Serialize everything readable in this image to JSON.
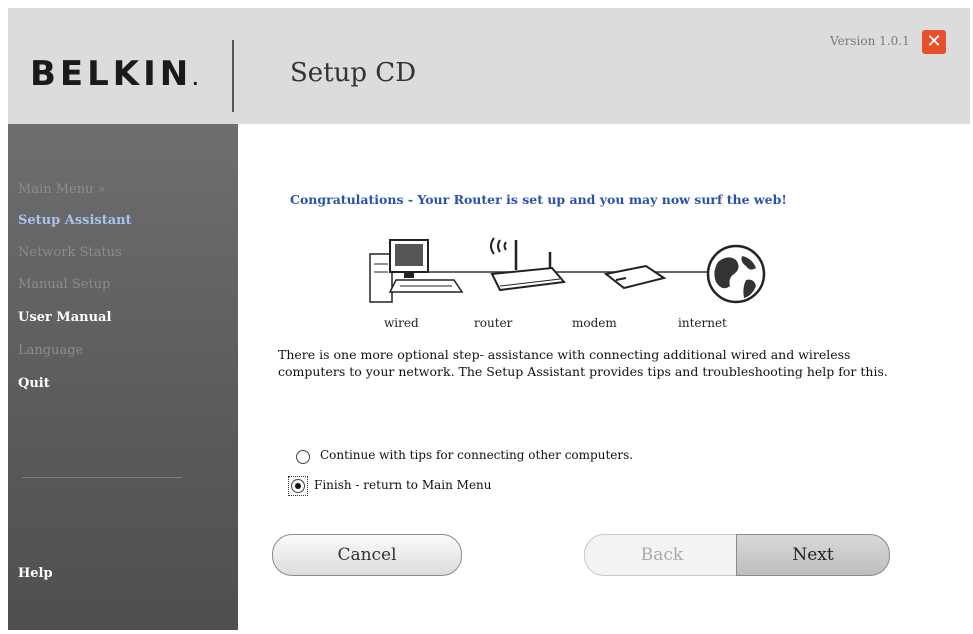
{
  "header": {
    "logo_text": "BELKIN",
    "logo_mark": ".",
    "title": "Setup CD",
    "version": "Version 1.0.1",
    "close_glyph": "✕",
    "close_icon": "close-icon",
    "accent_color": "#e8502d"
  },
  "sidebar": {
    "items": [
      {
        "label": "Main Menu  »"
      },
      {
        "label": "Setup Assistant"
      },
      {
        "label": "Network Status"
      },
      {
        "label": "Manual Setup"
      },
      {
        "label": "User Manual"
      },
      {
        "label": "Language"
      },
      {
        "label": "Quit"
      }
    ],
    "help": "Help"
  },
  "main": {
    "congrats": "Congratulations - Your Router is set up and you may now surf the web!",
    "diagram_labels": [
      "wired",
      "router",
      "modem",
      "internet"
    ],
    "paragraph": "There is one more optional step- assistance with connecting additional wired and wireless computers to your network. The Setup Assistant provides tips and troubleshooting help for this.",
    "options": [
      {
        "label": "Continue with tips for connecting other computers.",
        "selected": false
      },
      {
        "label": "Finish - return to Main Menu",
        "selected": true
      }
    ]
  },
  "buttons": {
    "cancel": "Cancel",
    "back": "Back",
    "next": "Next"
  }
}
